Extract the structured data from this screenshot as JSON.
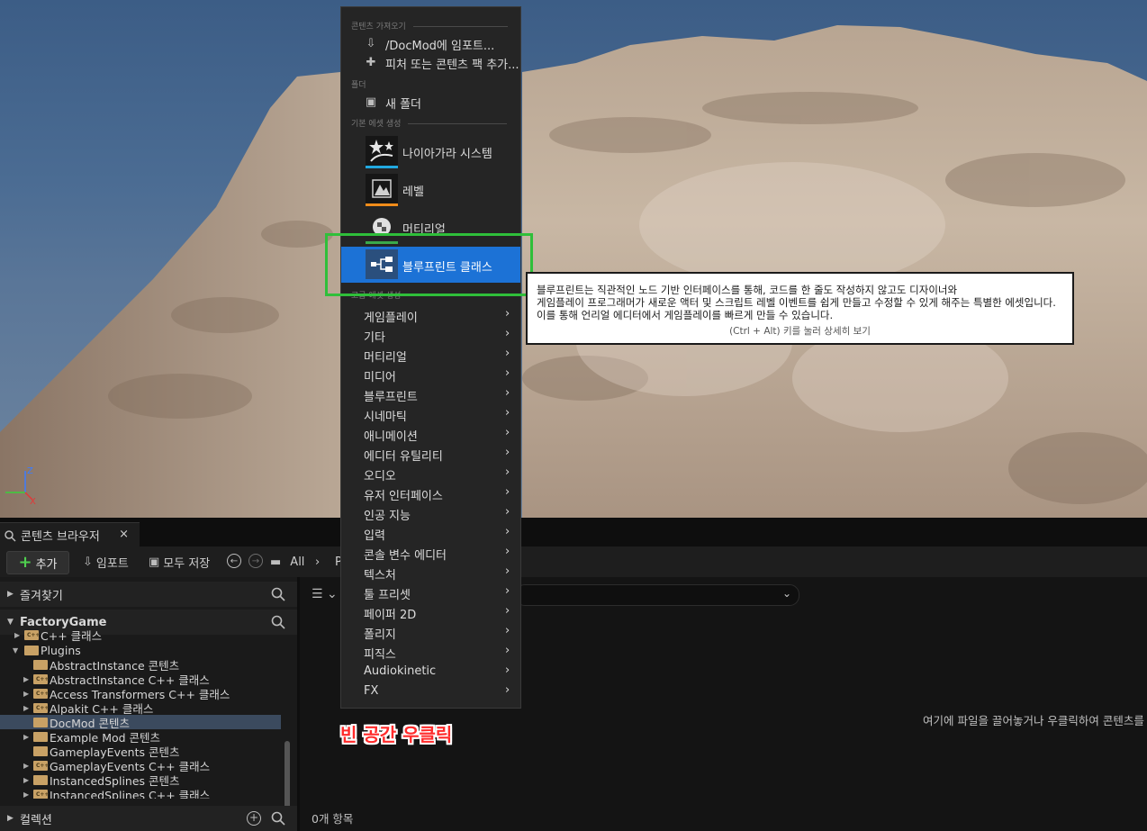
{
  "context_menu": {
    "sections": {
      "get_content": "콘텐츠 가져오기",
      "folder": "폴더",
      "basic_assets": "기본 에셋 생성",
      "advanced_assets": "고급 에셋 생성"
    },
    "import_label": "/DocMod에 임포트...",
    "add_feature_label": "피처 또는 콘텐츠 팩 추가...",
    "new_folder_label": "새 폴더",
    "assets": [
      {
        "label": "나이아가라 시스템",
        "color": "#21a8e0"
      },
      {
        "label": "레벨",
        "color": "#f08c1a"
      },
      {
        "label": "머티리얼",
        "color": "#3aa94a"
      },
      {
        "label": "블루프린트 클래스",
        "color": "#3a7bd5"
      }
    ],
    "submenus": [
      "게임플레이",
      "기타",
      "머티리얼",
      "미디어",
      "블루프린트",
      "시네마틱",
      "애니메이션",
      "에디터 유틸리티",
      "오디오",
      "유저 인터페이스",
      "인공 지능",
      "입력",
      "콘솔 변수 에디터",
      "텍스처",
      "툴 프리셋",
      "페이퍼 2D",
      "폴리지",
      "피직스",
      "Audiokinetic",
      "FX"
    ]
  },
  "tooltip": {
    "line1": "블루프린트는 직관적인 노드 기반 인터페이스를 통해, 코드를 한 줄도 작성하지 않고도 디자이너와",
    "line2": "게임플레이 프로그래머가 새로운 액터 및 스크립트 레벨 이벤트를 쉽게 만들고 수정할 수 있게 해주는 특별한 에셋입니다.",
    "line3": "이를 통해 언리얼 에디터에서 게임플레이를 빠르게 만들 수 있습니다.",
    "hint": "(Ctrl + Alt) 키를 눌러 상세히 보기"
  },
  "content_browser": {
    "tab_label": "콘텐츠 브라우저",
    "close": "×",
    "add_label": "추가",
    "import_label": "임포트",
    "save_all_label": "모두 저장",
    "path_all": "All",
    "path_next": "P",
    "favorites_label": "즐겨찾기",
    "project_label": "FactoryGame",
    "collections_label": "컬렉션",
    "tree": [
      {
        "label": "C++ 클래스",
        "type": "cpp"
      },
      {
        "label": "Plugins",
        "type": "open"
      },
      {
        "label": "AbstractInstance 콘텐츠",
        "type": "folder"
      },
      {
        "label": "AbstractInstance C++ 클래스",
        "type": "cpp"
      },
      {
        "label": "Access Transformers C++ 클래스",
        "type": "cpp"
      },
      {
        "label": "Alpakit C++ 클래스",
        "type": "cpp"
      },
      {
        "label": "DocMod 콘텐츠",
        "type": "folder"
      },
      {
        "label": "Example Mod 콘텐츠",
        "type": "folder"
      },
      {
        "label": "GameplayEvents 콘텐츠",
        "type": "folder"
      },
      {
        "label": "GameplayEvents C++ 클래스",
        "type": "cpp"
      },
      {
        "label": "InstancedSplines 콘텐츠",
        "type": "folder"
      },
      {
        "label": "InstancedSplines C++ 클래스",
        "type": "cpp"
      }
    ],
    "empty_hint": "여기에 파일을 끌어놓거나 우클릭하여 콘텐츠를",
    "item_count": "0개 항목"
  },
  "annotation": "빈 공간 우클릭",
  "axis_labels": {
    "z": "Z",
    "x": "X"
  },
  "colors": {
    "highlight": "#1c72d6",
    "annotation_box": "#2fbf3a",
    "annotation_text": "#ff2a2a"
  }
}
